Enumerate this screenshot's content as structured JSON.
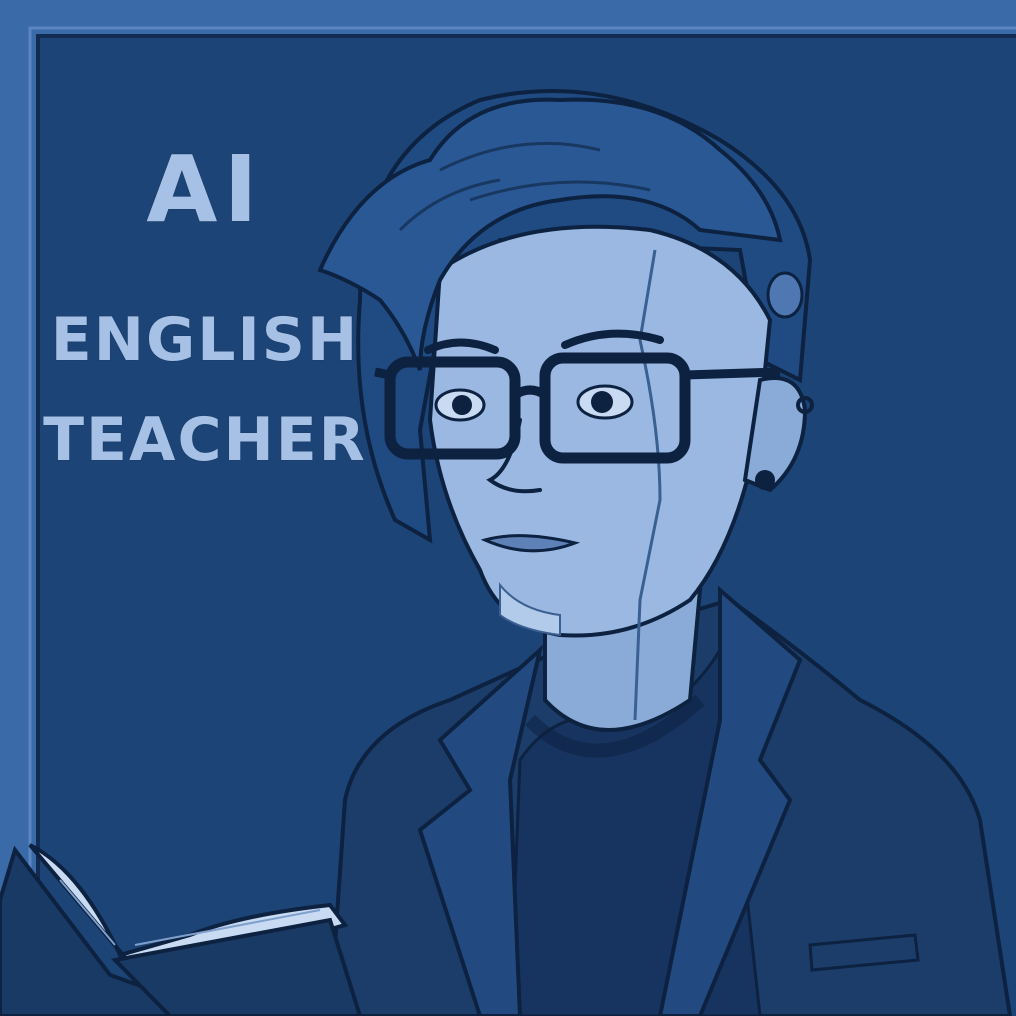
{
  "poster": {
    "line1": "AI",
    "line2": "ENGLISH",
    "line3": "TEACHER"
  },
  "palette": {
    "frame": "#3b6aa8",
    "board": "#1d4476",
    "text": "#a7c1e6",
    "skin": "#9ab8e1",
    "hair": "#1f4a82",
    "jacket": "#1c3c6a",
    "outline": "#0d2140"
  }
}
